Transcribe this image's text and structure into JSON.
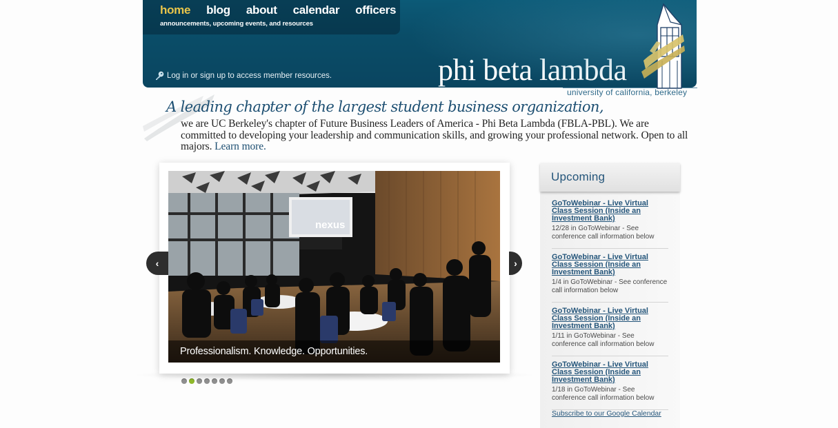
{
  "nav": {
    "items": [
      {
        "label": "home",
        "active": true
      },
      {
        "label": "blog"
      },
      {
        "label": "about"
      },
      {
        "label": "calendar"
      },
      {
        "label": "officers"
      }
    ],
    "subtitle": "announcements, upcoming events, and resources"
  },
  "header": {
    "login_text": "Log in or sign up to access member resources.",
    "brand": "phi beta lambda",
    "subbrand": "university of california, berkeley",
    "colors": {
      "banner": "#0a4d68",
      "active_nav": "#e9c54a",
      "link": "#24557a"
    }
  },
  "intro": {
    "tagline": "A leading chapter of the largest student business organization,",
    "body": "we are UC Berkeley's chapter of Future Business Leaders of America - Phi Beta Lambda (FBLA-PBL). We are committed to developing your leadership and communication skills, and growing your professional network. Open to all majors.",
    "learn_more": "Learn more."
  },
  "slider": {
    "caption": "Professionalism. Knowledge. Opportunities.",
    "screen_text": "nexus",
    "slide_count": 7,
    "active_index": 1,
    "prev_icon": "chevron-left-icon",
    "next_icon": "chevron-right-icon"
  },
  "upcoming": {
    "title": "Upcoming",
    "events": [
      {
        "title": "GoToWebinar - Live Virtual Class Session (Inside an Investment Bank)",
        "meta": "12/28 in GoToWebinar - See conference call information below"
      },
      {
        "title": "GoToWebinar - Live Virtual Class Session (Inside an Investment Bank)",
        "meta": "1/4 in GoToWebinar - See conference call information below"
      },
      {
        "title": "GoToWebinar - Live Virtual Class Session (Inside an Investment Bank)",
        "meta": "1/11 in GoToWebinar - See conference call information below"
      },
      {
        "title": "GoToWebinar - Live Virtual Class Session (Inside an Investment Bank)",
        "meta": "1/18 in GoToWebinar - See conference call information below"
      }
    ],
    "subscribe": "Subscribe to our Google Calendar"
  }
}
